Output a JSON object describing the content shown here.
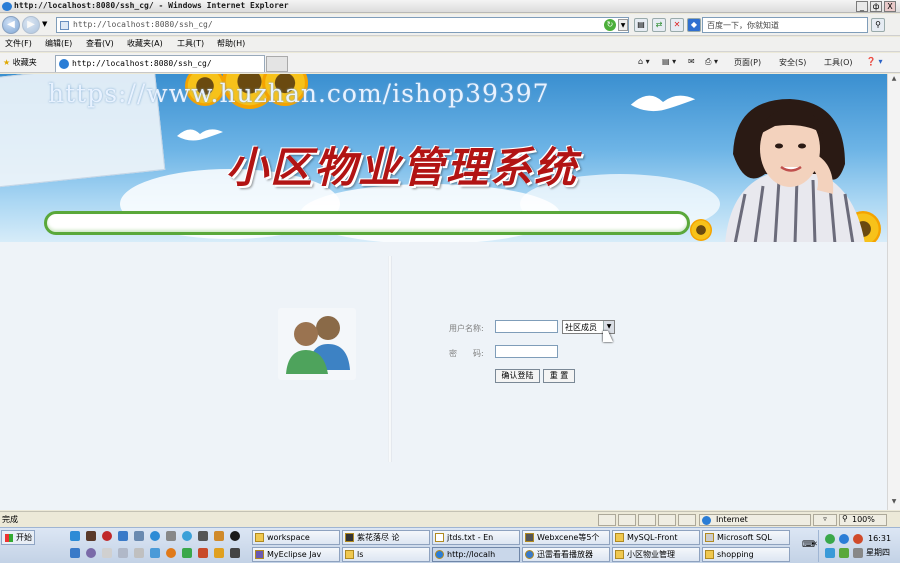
{
  "window": {
    "title": "http://localhost:8080/ssh_cg/ - Windows Internet Explorer",
    "min_label": "_",
    "max_label": "ф",
    "close_label": "X"
  },
  "addressbar": {
    "url": "http://localhost:8080/ssh_cg/",
    "search_placeholder": "百度一下，你就知道"
  },
  "menu": {
    "file": "文件(F)",
    "edit": "编辑(E)",
    "view": "查看(V)",
    "favorites": "收藏夹(A)",
    "tools": "工具(T)",
    "help": "帮助(H)"
  },
  "favbar": {
    "favorites": "收藏夹",
    "tab_url": "http://localhost:8080/ssh_cg/",
    "page": "页面(P)",
    "safety": "安全(S)",
    "tools": "工具(O)"
  },
  "banner": {
    "watermark": "https://www.huzhan.com/ishop39397",
    "title": "小区物业管理系统"
  },
  "login": {
    "username_label": "用户名称:",
    "password_label": "密　　码:",
    "role_selected": "社区成员",
    "submit_label": "确认登陆",
    "reset_label": "重 置"
  },
  "status": {
    "text": "完成",
    "zone": "Internet",
    "zoom": "100%"
  },
  "taskbar": {
    "start": "开始",
    "row1": [
      "workspace",
      "紫花落尽 论",
      "jtds.txt - En",
      "Webxcene等5个",
      "MySQL-Front",
      "Microsoft SQL"
    ],
    "row2": [
      "MyEclipse Jav",
      "ls",
      "http://localh",
      "迅雷看看播放器",
      "小区物业管理",
      "shopping"
    ],
    "clock": "16:31",
    "weekday": "星期四"
  }
}
